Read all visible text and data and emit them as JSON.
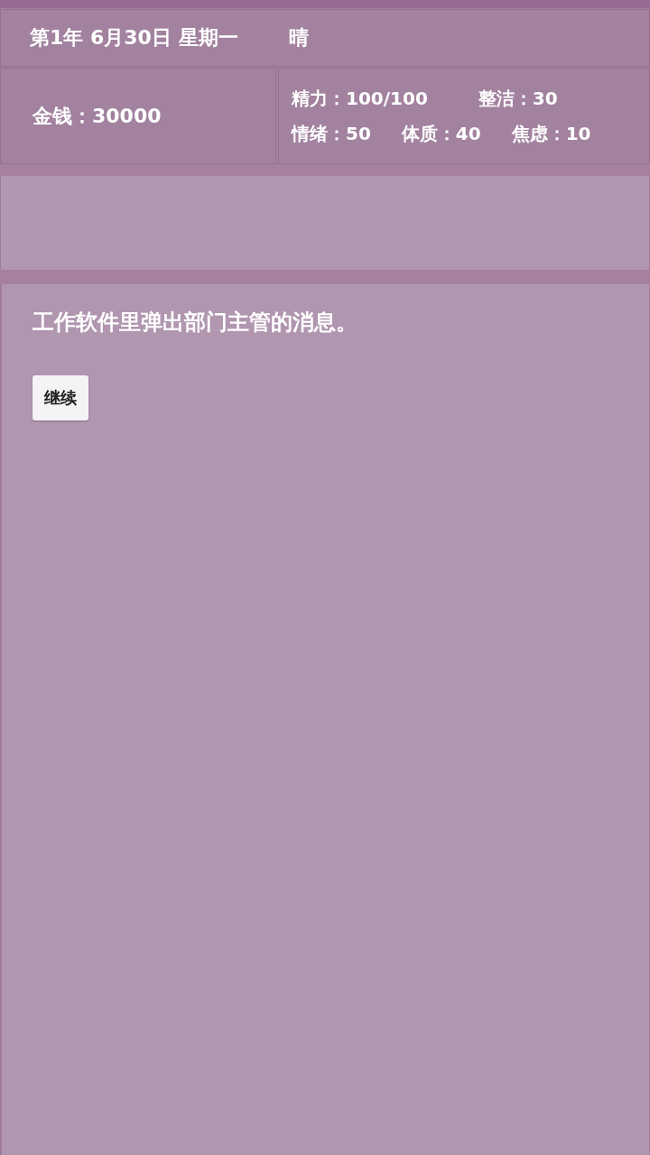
{
  "header": {
    "date": "第1年 6月30日 星期一",
    "weather": "晴"
  },
  "stats": {
    "money": "金钱：30000",
    "attribute_rows": [
      {
        "items": [
          "精力：100/100",
          "整洁：30"
        ]
      },
      {
        "items": [
          "情绪：50",
          "体质：40",
          "焦虑：10"
        ]
      }
    ]
  },
  "message": {
    "text": "工作软件里弹出部门主管的消息。",
    "buttons": [
      "继续"
    ]
  }
}
